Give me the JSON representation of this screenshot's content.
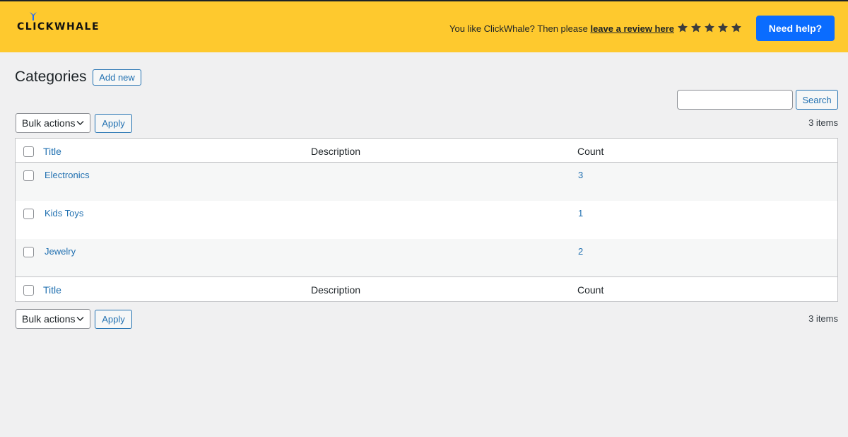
{
  "header": {
    "logo_text": "CLICKWHALE",
    "review_prefix": "You like ClickWhale? Then please",
    "review_link": "leave a review here",
    "stars": 5,
    "help_button": "Need help?",
    "colors": {
      "bar": "#fec92e",
      "help_button": "#0a6cff",
      "link": "#2271b1"
    }
  },
  "page": {
    "title": "Categories",
    "add_new": "Add new"
  },
  "search": {
    "placeholder": "",
    "value": "",
    "button": "Search"
  },
  "toolbar_top": {
    "bulk_label": "Bulk actions",
    "apply": "Apply",
    "count": "3 items"
  },
  "toolbar_bottom": {
    "bulk_label": "Bulk actions",
    "apply": "Apply",
    "count": "3 items"
  },
  "table": {
    "columns": [
      "Title",
      "Description",
      "Count"
    ],
    "rows": [
      {
        "title": "Electronics",
        "description": "",
        "count": "3"
      },
      {
        "title": "Kids Toys",
        "description": "",
        "count": "1"
      },
      {
        "title": "Jewelry",
        "description": "",
        "count": "2"
      }
    ]
  }
}
